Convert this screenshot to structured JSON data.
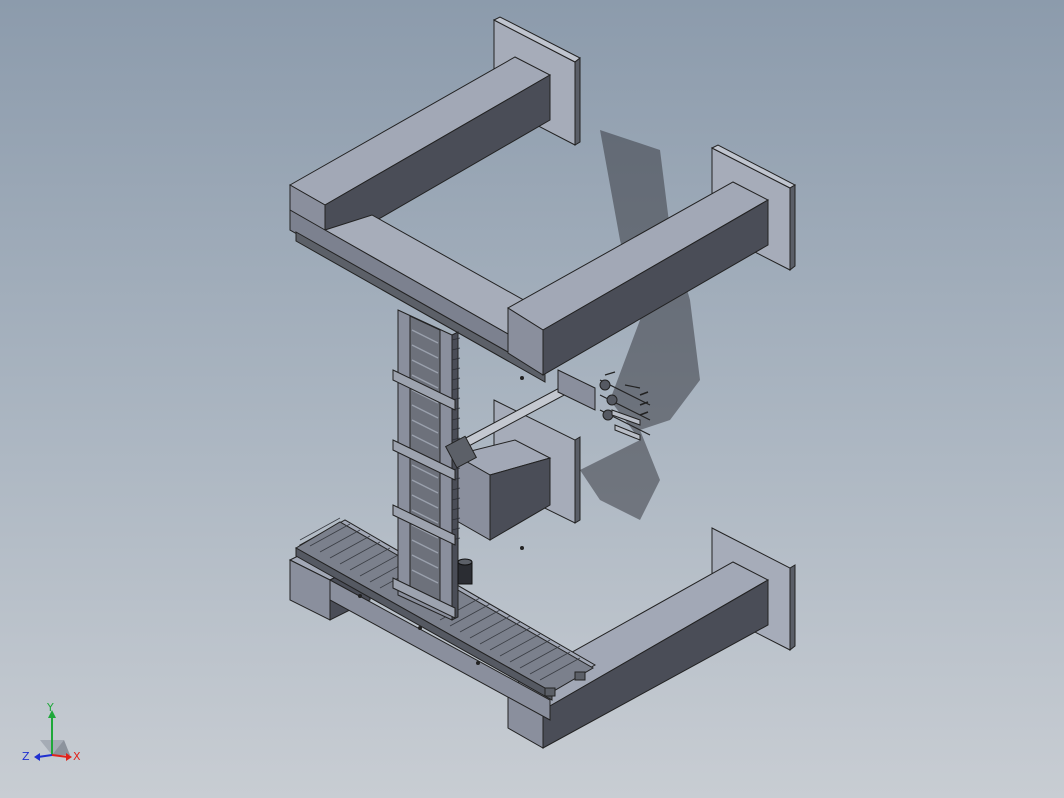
{
  "viewport": {
    "background_top": "#8c9bac",
    "background_bottom": "#c8cdd3"
  },
  "model": {
    "face_top": "#a2a8b6",
    "face_front": "#8a8f9d",
    "face_side": "#4a4d57",
    "rail_color": "#5c6068",
    "shadow_color": "#3a3d44"
  },
  "triad": {
    "x_label": "X",
    "y_label": "Y",
    "z_label": "Z",
    "x_color": "#e0231b",
    "y_color": "#1fa83a",
    "z_color": "#2030d0"
  }
}
